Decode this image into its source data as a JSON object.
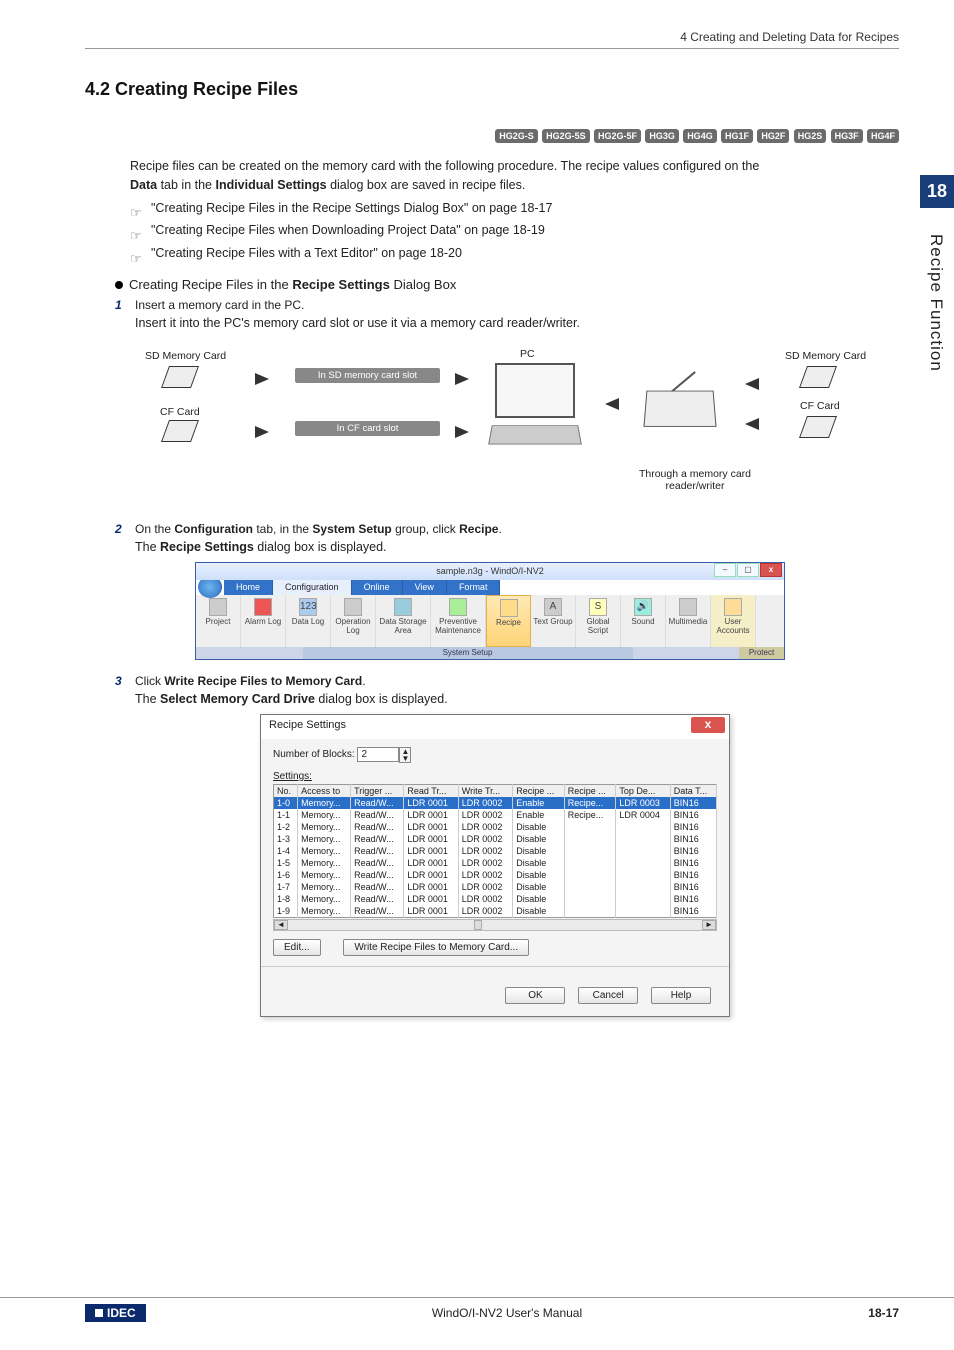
{
  "breadcrumb": "4 Creating and Deleting Data for Recipes",
  "section_number_title": "4.2   Creating Recipe Files",
  "tags": [
    "HG2G-S",
    "HG2G-5S",
    "HG2G-5F",
    "HG3G",
    "HG4G",
    "HG1F",
    "HG2F",
    "HG2S",
    "HG3F",
    "HG4F"
  ],
  "intro_line1": "Recipe files can be created on the memory card with the following procedure. The recipe values configured on the",
  "intro_line2_prefix": "Data",
  "intro_line2_mid": " tab in the ",
  "intro_line2_bold2": "Individual Settings",
  "intro_line2_suffix": " dialog box are saved in recipe files.",
  "links": [
    "\"Creating Recipe Files in the Recipe Settings Dialog Box\" on page 18-17",
    "\"Creating Recipe Files when Downloading Project Data\" on page 18-19",
    "\"Creating Recipe Files with a Text Editor\" on page 18-20"
  ],
  "subhead_plain1": "Creating Recipe Files in the ",
  "subhead_bold": "Recipe Settings",
  "subhead_plain2": " Dialog Box",
  "step1_num": "1",
  "step1_text": "Insert a memory card in the PC.",
  "step1_sub": "Insert it into the PC's memory card slot or use it via a memory card reader/writer.",
  "diagram": {
    "sd_card": "SD Memory Card",
    "cf_card": "CF Card",
    "slot_sd": "In SD memory card slot",
    "slot_cf": "In CF card slot",
    "pc": "PC",
    "reader": "Through a memory card reader/writer"
  },
  "step2_num": "2",
  "step2_prefix": "On the ",
  "step2_b1": "Configuration",
  "step2_mid1": " tab, in the ",
  "step2_b2": "System Setup",
  "step2_mid2": " group, click ",
  "step2_b3": "Recipe",
  "step2_suffix": ".",
  "step2_sub_prefix": "The ",
  "step2_sub_bold": "Recipe Settings",
  "step2_sub_suffix": " dialog box is displayed.",
  "ribbon": {
    "win_title": "sample.n3g - WindO/I-NV2",
    "tabs": [
      "Home",
      "Configuration",
      "Online",
      "View",
      "Format"
    ],
    "buttons": [
      "Project",
      "Alarm Log",
      "Data Log",
      "Operation Log",
      "Data Storage Area",
      "Preventive Maintenance",
      "Recipe",
      "Text Group",
      "Global Script",
      "Sound",
      "Multimedia",
      "User Accounts"
    ],
    "group_label": "System Setup",
    "protect": "Protect"
  },
  "step3_num": "3",
  "step3_prefix": "Click ",
  "step3_bold": "Write Recipe Files to Memory Card",
  "step3_suffix": ".",
  "step3_sub_prefix": "The ",
  "step3_sub_bold": "Select Memory Card Drive",
  "step3_sub_suffix": " dialog box is displayed.",
  "dialog": {
    "title": "Recipe Settings",
    "num_blocks_label": "Number of Blocks:",
    "num_blocks_val": "2",
    "settings_label": "Settings:",
    "headers": [
      "No.",
      "Access to",
      "Trigger ...",
      "Read Tr...",
      "Write Tr...",
      "Recipe ...",
      "Recipe ...",
      "Top De...",
      "Data T..."
    ],
    "rows": [
      [
        "1-0",
        "Memory...",
        "Read/W...",
        "LDR 0001",
        "LDR 0002",
        "Enable",
        "Recipe...",
        "LDR 0003",
        "BIN16"
      ],
      [
        "1-1",
        "Memory...",
        "Read/W...",
        "LDR 0001",
        "LDR 0002",
        "Enable",
        "Recipe...",
        "LDR 0004",
        "BIN16"
      ],
      [
        "1-2",
        "Memory...",
        "Read/W...",
        "LDR 0001",
        "LDR 0002",
        "Disable",
        "",
        "",
        "BIN16"
      ],
      [
        "1-3",
        "Memory...",
        "Read/W...",
        "LDR 0001",
        "LDR 0002",
        "Disable",
        "",
        "",
        "BIN16"
      ],
      [
        "1-4",
        "Memory...",
        "Read/W...",
        "LDR 0001",
        "LDR 0002",
        "Disable",
        "",
        "",
        "BIN16"
      ],
      [
        "1-5",
        "Memory...",
        "Read/W...",
        "LDR 0001",
        "LDR 0002",
        "Disable",
        "",
        "",
        "BIN16"
      ],
      [
        "1-6",
        "Memory...",
        "Read/W...",
        "LDR 0001",
        "LDR 0002",
        "Disable",
        "",
        "",
        "BIN16"
      ],
      [
        "1-7",
        "Memory...",
        "Read/W...",
        "LDR 0001",
        "LDR 0002",
        "Disable",
        "",
        "",
        "BIN16"
      ],
      [
        "1-8",
        "Memory...",
        "Read/W...",
        "LDR 0001",
        "LDR 0002",
        "Disable",
        "",
        "",
        "BIN16"
      ],
      [
        "1-9",
        "Memory...",
        "Read/W...",
        "LDR 0001",
        "LDR 0002",
        "Disable",
        "",
        "",
        "BIN16"
      ]
    ],
    "edit_btn": "Edit...",
    "write_btn": "Write Recipe Files to Memory Card...",
    "ok": "OK",
    "cancel": "Cancel",
    "help": "Help"
  },
  "side_tab_num": "18",
  "side_tab_text": "Recipe Function",
  "footer": {
    "logo": "IDEC",
    "center": "WindO/I-NV2 User's Manual",
    "right": "18-17"
  }
}
